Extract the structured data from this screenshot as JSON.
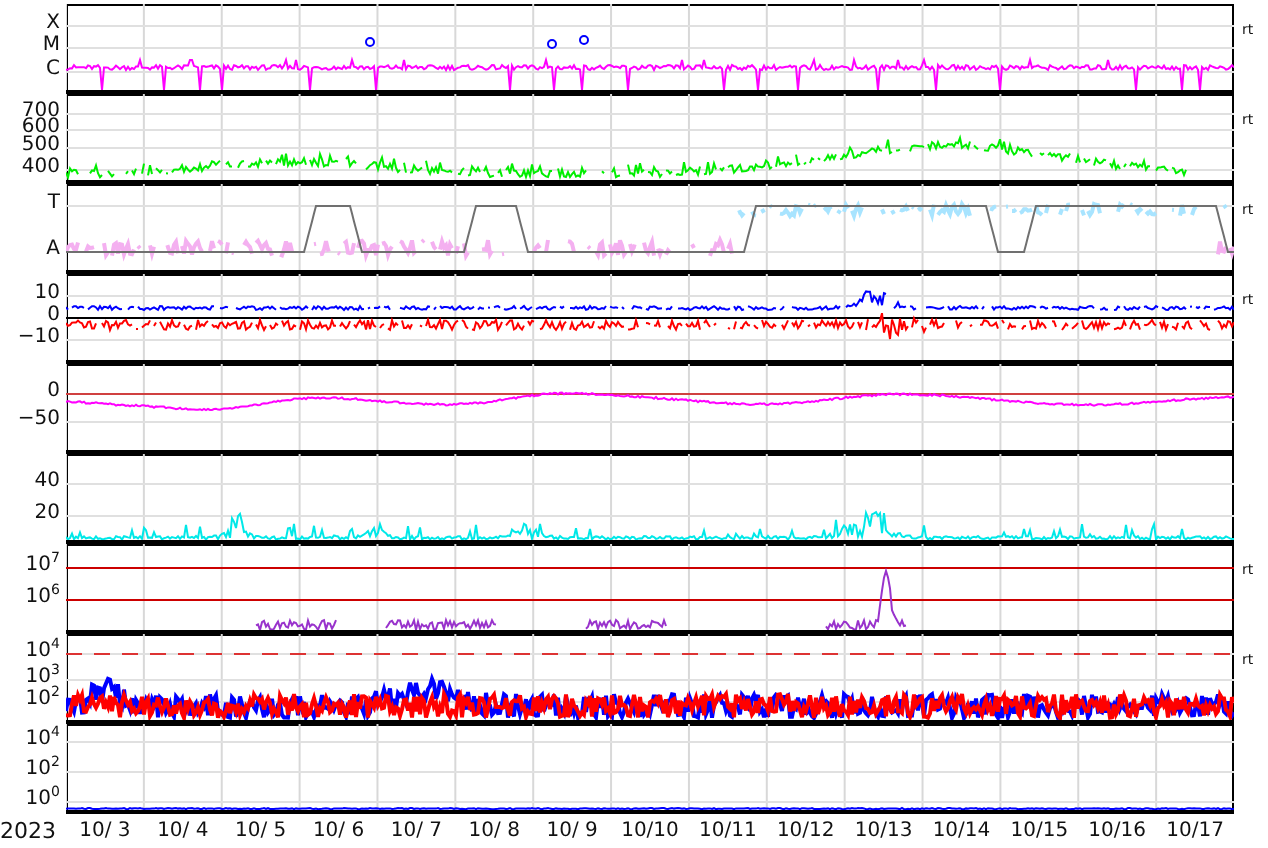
{
  "panels": [
    {
      "ticks": [
        "X",
        "M",
        "C"
      ],
      "flag": "rt",
      "series": [
        {
          "color": "#ff00ff"
        }
      ]
    },
    {
      "ticks": [
        "700",
        "600",
        "500",
        "400"
      ],
      "flag": "rt",
      "series": [
        {
          "color": "#00ee00"
        }
      ]
    },
    {
      "ticks": [
        "T",
        "A"
      ],
      "flag": "rt",
      "series": [
        {
          "color": "#a8e4ff"
        },
        {
          "color": "#f4b0f0"
        },
        {
          "color": "#707070"
        }
      ]
    },
    {
      "ticks": [
        "10",
        "0",
        "−10"
      ],
      "flag": "rt",
      "series": [
        {
          "color": "#0000ff"
        },
        {
          "color": "#ff0000"
        }
      ]
    },
    {
      "ticks": [
        "0",
        "−50"
      ],
      "series": [
        {
          "color": "#ff00ff"
        }
      ]
    },
    {
      "ticks": [
        "40",
        "20"
      ],
      "series": [
        {
          "color": "#00e8e8"
        }
      ]
    },
    {
      "ticks": [
        "10$^{7}$",
        "10$^{6}$"
      ],
      "flag": "rt",
      "series": [
        {
          "color": "#9933cc"
        }
      ]
    },
    {
      "ticks": [
        "10$^{4}$",
        "10$^{3}$",
        "10$^{2}$"
      ],
      "flag": "rt",
      "series": [
        {
          "color": "#0000ff"
        },
        {
          "color": "#ff0000"
        }
      ]
    },
    {
      "ticks": [
        "10$^{4}$",
        "10$^{2}$",
        "10$^{0}$"
      ],
      "series": [
        {
          "color": "#0000ff"
        }
      ]
    }
  ],
  "x_axis": {
    "year": "2023",
    "dates": [
      "10/ 3",
      "10/ 4",
      "10/ 5",
      "10/ 6",
      "10/ 7",
      "10/ 8",
      "10/ 9",
      "10/10",
      "10/11",
      "10/12",
      "10/13",
      "10/14",
      "10/15",
      "10/16",
      "10/17"
    ]
  }
}
